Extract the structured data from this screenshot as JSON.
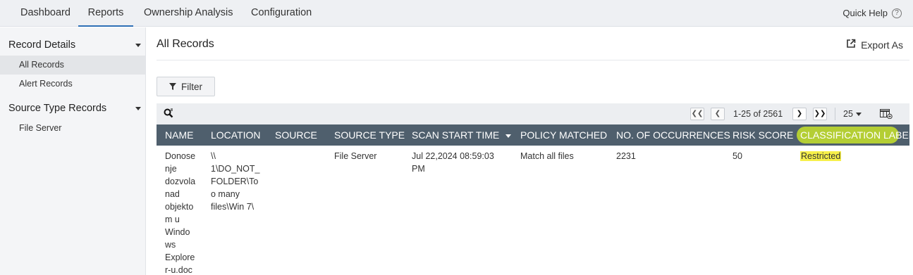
{
  "topnav": {
    "tabs": [
      {
        "label": "Dashboard"
      },
      {
        "label": "Reports"
      },
      {
        "label": "Ownership Analysis"
      },
      {
        "label": "Configuration"
      }
    ],
    "active_tab": "Reports",
    "quick_help": "Quick Help",
    "quick_help_icon": "?"
  },
  "sidebar": {
    "sections": [
      {
        "title": "Record Details",
        "items": [
          {
            "label": "All Records"
          },
          {
            "label": "Alert Records"
          }
        ]
      },
      {
        "title": "Source Type Records",
        "items": [
          {
            "label": "File Server"
          }
        ]
      }
    ],
    "active_item": "All Records"
  },
  "main": {
    "title": "All Records",
    "export_label": "Export As",
    "filter_label": "Filter"
  },
  "pagination": {
    "range_text": "1-25 of 2561",
    "page_size": "25"
  },
  "table": {
    "columns": [
      "NAME",
      "LOCATION",
      "SOURCE",
      "SOURCE TYPE",
      "SCAN START TIME",
      "POLICY MATCHED",
      "NO. OF OCCURRENCES",
      "RISK SCORE",
      "CLASSIFICATION LABEL"
    ],
    "sorted_column": "SCAN START TIME",
    "rows": [
      {
        "name_lines": [
          "Donose",
          "nje",
          "dozvola",
          "nad",
          "objekto",
          "m u",
          "Windo",
          "ws",
          "Explore",
          "r-u.doc"
        ],
        "location_lines": [
          "\\\\",
          "1\\DO_NOT_",
          "FOLDER\\To",
          "o many",
          "files\\Win 7\\"
        ],
        "source": "",
        "source_type": "File Server",
        "scan_start_time_lines": [
          "Jul 22,2024 08:59:03",
          "PM"
        ],
        "policy_matched": "Match all files",
        "occurrences": "2231",
        "risk_score": "50",
        "classification_label": "Restricted"
      }
    ]
  },
  "colors": {
    "accent": "#2d6fb5",
    "table_header_bg": "#4f5f6d",
    "highlight": "#f7f04a"
  }
}
